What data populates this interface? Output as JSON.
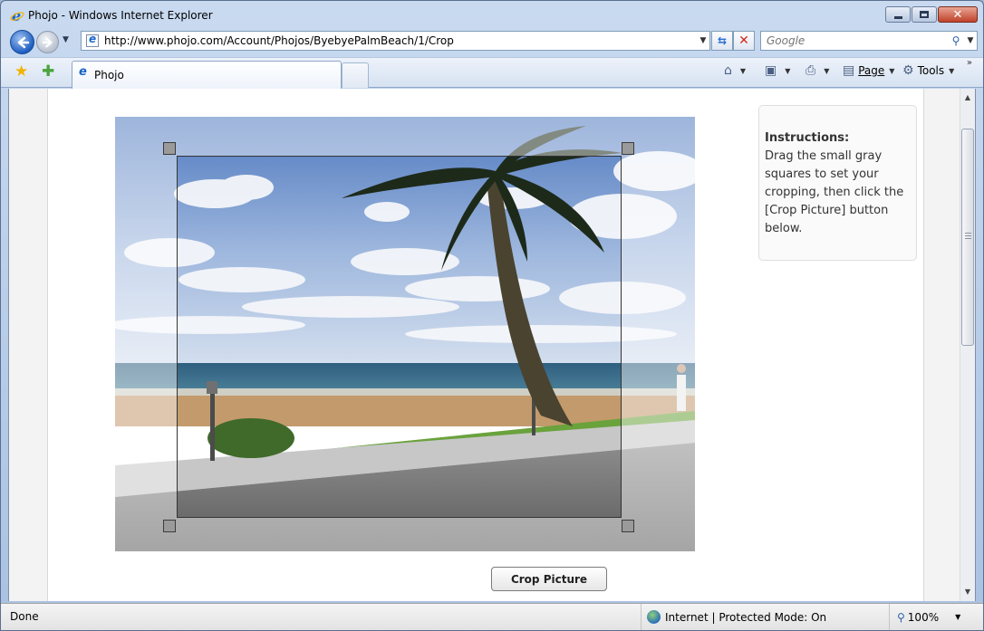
{
  "window": {
    "title": "Phojo - Windows Internet Explorer"
  },
  "address_bar": {
    "url": "http://www.phojo.com/Account/Phojos/ByebyePalmBeach/1/Crop"
  },
  "search": {
    "placeholder": "Google"
  },
  "tabs": [
    {
      "label": "Phojo"
    }
  ],
  "command_bar": {
    "page_label": "Page",
    "tools_label": "Tools",
    "overflow": "»"
  },
  "page": {
    "instructions_title": "Instructions:",
    "instructions_text": "Drag the small gray squares to set your cropping, then click the [Crop Picture] button below.",
    "crop_button_label": "Crop Picture"
  },
  "status_bar": {
    "status": "Done",
    "zone": "Internet | Protected Mode: On",
    "zoom": "100%"
  },
  "icons": {
    "window": "ie-logo-icon",
    "back": "back-arrow-icon",
    "forward": "forward-arrow-icon",
    "refresh": "refresh-icon",
    "stop": "stop-icon",
    "search": "magnifier-icon",
    "favorites": "star-icon",
    "add_favorites": "add-favorite-icon",
    "home": "home-icon",
    "feeds": "rss-icon",
    "print": "printer-icon",
    "tools": "gear-icon",
    "zone": "globe-icon",
    "zoom": "zoom-icon"
  },
  "colors": {
    "handle": "#9a9a9a",
    "sky": "#6f93cc",
    "sea": "#3d6f86"
  }
}
